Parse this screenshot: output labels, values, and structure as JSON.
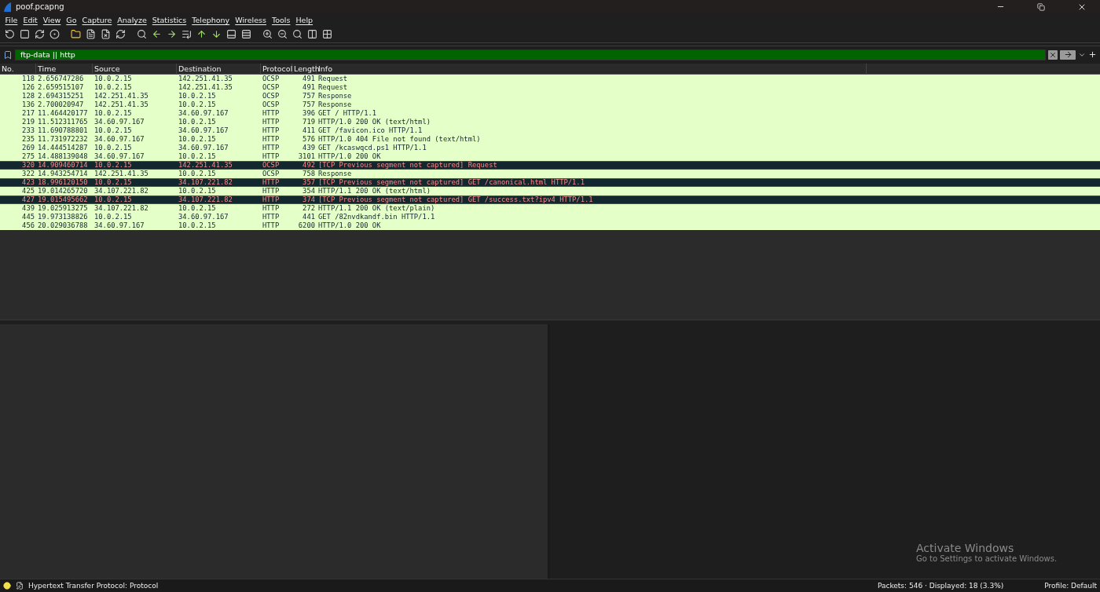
{
  "window": {
    "title": "poof.pcapng"
  },
  "menu": [
    "File",
    "Edit",
    "View",
    "Go",
    "Capture",
    "Analyze",
    "Statistics",
    "Telephony",
    "Wireless",
    "Tools",
    "Help"
  ],
  "filter": {
    "value": "ftp-data || http"
  },
  "table": {
    "columns": [
      "No.",
      "Time",
      "Source",
      "Destination",
      "Protocol",
      "Length",
      "Info"
    ],
    "rows": [
      {
        "kind": "normal",
        "cells": [
          "118",
          "2.656747286",
          "10.0.2.15",
          "142.251.41.35",
          "OCSP",
          "491",
          "Request"
        ]
      },
      {
        "kind": "normal",
        "cells": [
          "126",
          "2.659515107",
          "10.0.2.15",
          "142.251.41.35",
          "OCSP",
          "491",
          "Request"
        ]
      },
      {
        "kind": "normal",
        "cells": [
          "128",
          "2.694315251",
          "142.251.41.35",
          "10.0.2.15",
          "OCSP",
          "757",
          "Response"
        ]
      },
      {
        "kind": "normal",
        "cells": [
          "136",
          "2.700020947",
          "142.251.41.35",
          "10.0.2.15",
          "OCSP",
          "757",
          "Response"
        ]
      },
      {
        "kind": "normal",
        "cells": [
          "217",
          "11.464420177",
          "10.0.2.15",
          "34.60.97.167",
          "HTTP",
          "396",
          "GET / HTTP/1.1"
        ]
      },
      {
        "kind": "normal",
        "cells": [
          "219",
          "11.512311765",
          "34.60.97.167",
          "10.0.2.15",
          "HTTP",
          "719",
          "HTTP/1.0 200 OK  (text/html)"
        ]
      },
      {
        "kind": "normal",
        "cells": [
          "233",
          "11.690788801",
          "10.0.2.15",
          "34.60.97.167",
          "HTTP",
          "411",
          "GET /favicon.ico HTTP/1.1"
        ]
      },
      {
        "kind": "normal",
        "cells": [
          "235",
          "11.731972232",
          "34.60.97.167",
          "10.0.2.15",
          "HTTP",
          "576",
          "HTTP/1.0 404 File not found  (text/html)"
        ]
      },
      {
        "kind": "normal",
        "cells": [
          "269",
          "14.444514287",
          "10.0.2.15",
          "34.60.97.167",
          "HTTP",
          "439",
          "GET /kcaswqcd.ps1 HTTP/1.1"
        ]
      },
      {
        "kind": "normal",
        "cells": [
          "275",
          "14.488139048",
          "34.60.97.167",
          "10.0.2.15",
          "HTTP",
          "3101",
          "HTTP/1.0 200 OK"
        ]
      },
      {
        "kind": "problem",
        "cells": [
          "320",
          "14.909460714",
          "10.0.2.15",
          "142.251.41.35",
          "OCSP",
          "492",
          "[TCP Previous segment not captured] Request"
        ]
      },
      {
        "kind": "normal",
        "cells": [
          "322",
          "14.943254714",
          "142.251.41.35",
          "10.0.2.15",
          "OCSP",
          "758",
          "Response"
        ]
      },
      {
        "kind": "problem",
        "cells": [
          "423",
          "18.996120150",
          "10.0.2.15",
          "34.107.221.82",
          "HTTP",
          "357",
          "[TCP Previous segment not captured] GET /canonical.html HTTP/1.1"
        ]
      },
      {
        "kind": "normal",
        "cells": [
          "425",
          "19.014265720",
          "34.107.221.82",
          "10.0.2.15",
          "HTTP",
          "354",
          "HTTP/1.1 200 OK  (text/html)"
        ]
      },
      {
        "kind": "problem",
        "cells": [
          "427",
          "19.015495662",
          "10.0.2.15",
          "34.107.221.82",
          "HTTP",
          "374",
          "[TCP Previous segment not captured] GET /success.txt?ipv4 HTTP/1.1"
        ]
      },
      {
        "kind": "normal",
        "cells": [
          "439",
          "19.025913275",
          "34.107.221.82",
          "10.0.2.15",
          "HTTP",
          "272",
          "HTTP/1.1 200 OK  (text/plain)"
        ]
      },
      {
        "kind": "normal",
        "cells": [
          "445",
          "19.973138826",
          "10.0.2.15",
          "34.60.97.167",
          "HTTP",
          "441",
          "GET /82nvdkandf.bin HTTP/1.1"
        ]
      },
      {
        "kind": "normal",
        "cells": [
          "456",
          "20.029036788",
          "34.60.97.167",
          "10.0.2.15",
          "HTTP",
          "6200",
          "HTTP/1.0 200 OK"
        ]
      }
    ]
  },
  "activation": {
    "title": "Activate Windows",
    "subtitle": "Go to Settings to activate Windows."
  },
  "status_bar": {
    "field": "Hypertext Transfer Protocol: Protocol",
    "packets": "Packets: 546 · Displayed: 18 (3.3%)",
    "profile": "Profile: Default"
  }
}
